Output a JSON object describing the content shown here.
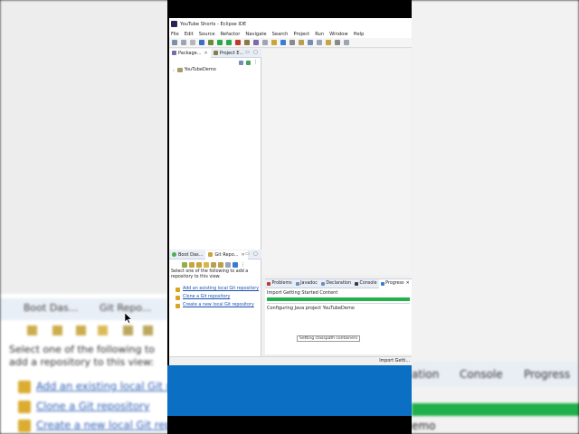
{
  "window": {
    "title": "YouTube Shorts - Eclipse IDE"
  },
  "menu": [
    "File",
    "Edit",
    "Source",
    "Refactor",
    "Navigate",
    "Search",
    "Project",
    "Run",
    "Window",
    "Help"
  ],
  "package_explorer": {
    "tabs": [
      {
        "label": "Package..."
      },
      {
        "label": "Project E..."
      }
    ],
    "project": "YouTubeDemo"
  },
  "git_panel": {
    "tabs": [
      {
        "label": "Boot Das..."
      },
      {
        "label": "Git Repo..."
      }
    ],
    "description": "Select one of the following to add a repository to this view:",
    "links": [
      "Add an existing local Git repository",
      "Clone a Git repository",
      "Create a new local Git repository"
    ]
  },
  "bottom_panel": {
    "tabs": [
      {
        "label": "Problems"
      },
      {
        "label": "Javadoc"
      },
      {
        "label": "Declaration"
      },
      {
        "label": "Console"
      },
      {
        "label": "Progress"
      }
    ],
    "task": "Import Getting Started Content",
    "progress_fraction": 1.0,
    "subtask": "Configuring Java project YouTubeDemo",
    "tooltip": "Setting classpath containers"
  },
  "status_bar": {
    "text": "Import Getti..."
  },
  "background": {
    "tabs": [
      {
        "label": "Boot Das..."
      },
      {
        "label": "Git Repo..."
      }
    ],
    "description": "Select one of the following to add a repository to this view:",
    "links": [
      "Add an existing local Git repository",
      "Clone a Git repository",
      "Create a new local Git repository"
    ],
    "right_tabs": [
      "ation",
      "Console",
      "Progress"
    ],
    "right_text": "emo"
  },
  "colors": {
    "progress": "#22b14c",
    "link": "#1a4fb0",
    "video_bar": "#0b6fc4"
  }
}
